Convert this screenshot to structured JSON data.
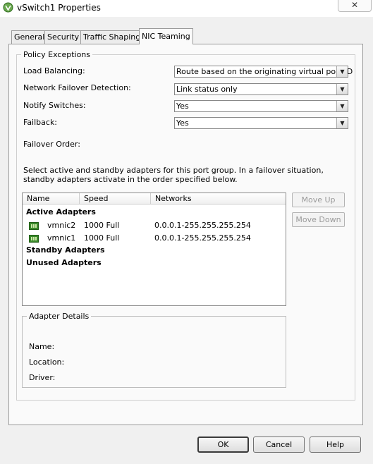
{
  "window": {
    "title": "vSwitch1 Properties",
    "close_glyph": "✕"
  },
  "tabs": [
    {
      "label": "General"
    },
    {
      "label": "Security"
    },
    {
      "label": "Traffic Shaping"
    },
    {
      "label": "NIC Teaming",
      "active": true
    }
  ],
  "policy": {
    "legend": "Policy Exceptions",
    "load_balancing": {
      "label": "Load Balancing:",
      "value": "Route based on the originating virtual port ID"
    },
    "failover_detection": {
      "label": "Network Failover Detection:",
      "value": "Link status only"
    },
    "notify_switches": {
      "label": "Notify Switches:",
      "value": "Yes"
    },
    "failback": {
      "label": "Failback:",
      "value": "Yes"
    },
    "failover_order_label": "Failover Order:",
    "instructions": "Select active and standby adapters for this port group.  In a failover situation, standby adapters activate  in the order specified below."
  },
  "table": {
    "columns": [
      "Name",
      "Speed",
      "Networks"
    ],
    "groups": {
      "active": "Active Adapters",
      "standby": "Standby Adapters",
      "unused": "Unused Adapters"
    },
    "rows": [
      {
        "name": "vmnic2",
        "speed": "1000 Full",
        "networks": "0.0.0.1-255.255.255.254"
      },
      {
        "name": "vmnic1",
        "speed": "1000 Full",
        "networks": "0.0.0.1-255.255.255.254"
      }
    ]
  },
  "side_buttons": {
    "move_up": "Move Up",
    "move_down": "Move Down"
  },
  "adapter_details": {
    "legend": "Adapter Details",
    "name_label": "Name:",
    "location_label": "Location:",
    "driver_label": "Driver:"
  },
  "footer": {
    "ok": "OK",
    "cancel": "Cancel",
    "help": "Help"
  },
  "icons": {
    "combo_arrow": "▼",
    "nic": "network-adapter-icon"
  }
}
